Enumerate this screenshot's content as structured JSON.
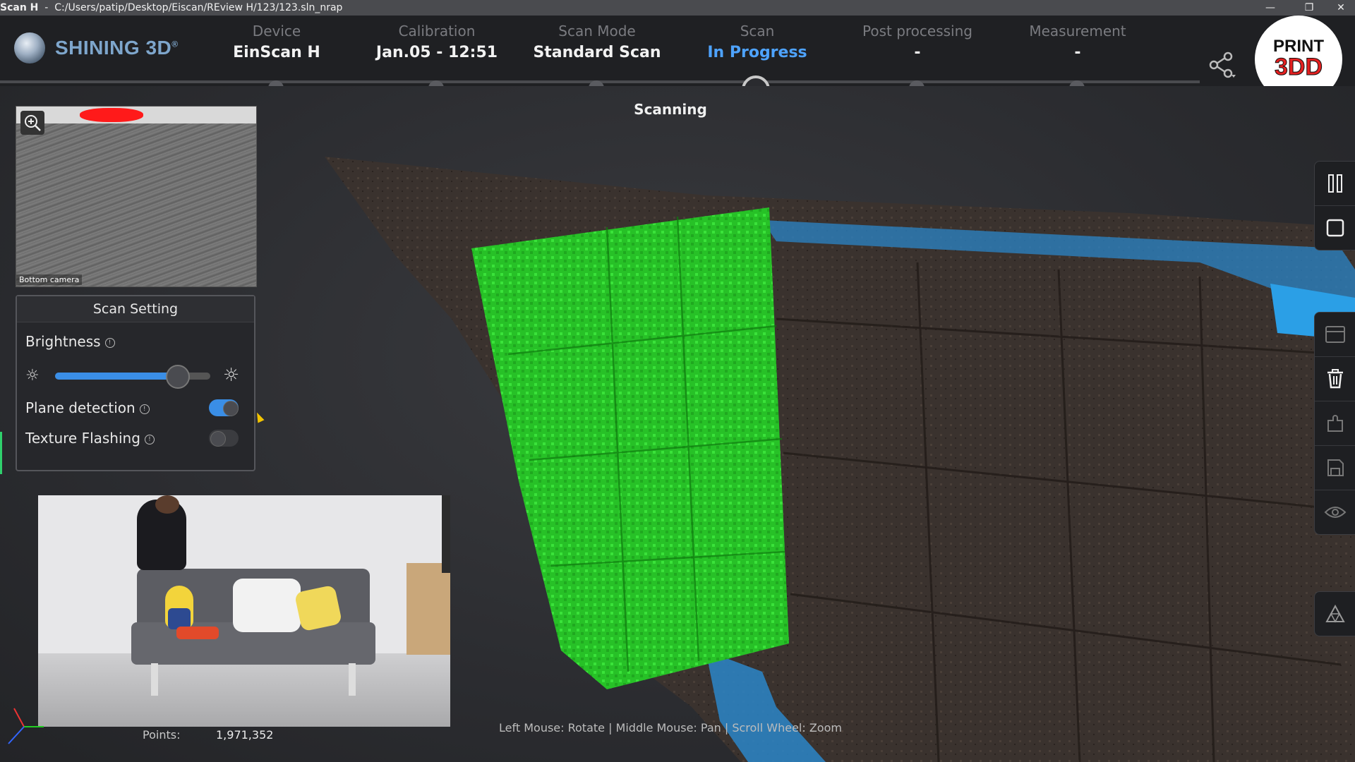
{
  "titlebar": {
    "app": "Scan H",
    "path": "C:/Users/patip/Desktop/Eiscan/REview H/123/123.sln_nrap"
  },
  "brand": {
    "name": "SHINING 3D",
    "registered": "®"
  },
  "steps": [
    {
      "label": "Device",
      "value": "EinScan H",
      "state": "done"
    },
    {
      "label": "Calibration",
      "value": "Jan.05 - 12:51",
      "state": "done"
    },
    {
      "label": "Scan Mode",
      "value": "Standard Scan",
      "state": "done"
    },
    {
      "label": "Scan",
      "value": "In Progress",
      "state": "active"
    },
    {
      "label": "Post processing",
      "value": "-",
      "state": "pending"
    },
    {
      "label": "Measurement",
      "value": "-",
      "state": "pending"
    }
  ],
  "status": "Scanning",
  "badge": {
    "line1": "PRINT",
    "line2": "3DD"
  },
  "camera": {
    "label": "Bottom camera"
  },
  "scan_setting": {
    "title": "Scan Setting",
    "brightness_label": "Brightness",
    "brightness_level": 0.78,
    "plane_detection_label": "Plane detection",
    "plane_detection_on": true,
    "texture_flashing_label": "Texture Flashing",
    "texture_flashing_on": false
  },
  "stats": {
    "points_label": "Points:",
    "points_value": "1,971,352"
  },
  "hint": "Left Mouse: Rotate | Middle Mouse: Pan | Scroll Wheel: Zoom",
  "colors": {
    "accent": "#4ea3ff",
    "scan_green": "#2bd12b",
    "scan_blue": "#2b8fd6",
    "toggle_on": "#3a8ee6"
  },
  "toolbar_icons": [
    "pause-icon",
    "stop-icon",
    "panel-icon",
    "trash-icon",
    "puzzle-icon",
    "save-icon",
    "eye-icon",
    "mesh-icon"
  ]
}
